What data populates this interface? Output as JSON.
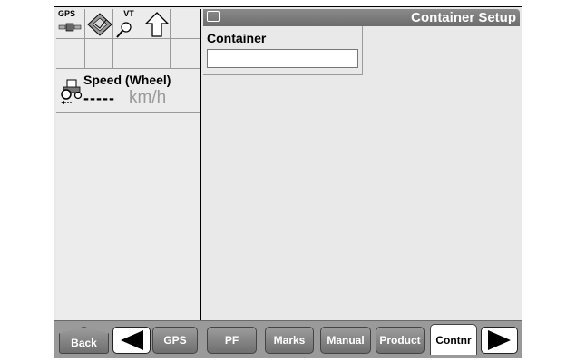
{
  "status": {
    "gps_tag": "GPS",
    "vt_tag": "VT"
  },
  "speed": {
    "title": "Speed (Wheel)",
    "value": "-----",
    "unit": "km/h"
  },
  "header": {
    "title": "Container Setup"
  },
  "container": {
    "label": "Container",
    "value": ""
  },
  "toolbar": {
    "back": "Back",
    "gps": "GPS",
    "pf": "PF",
    "marks": "Marks",
    "manual": "Manual",
    "product": "Product",
    "contnr": "Contnr"
  }
}
